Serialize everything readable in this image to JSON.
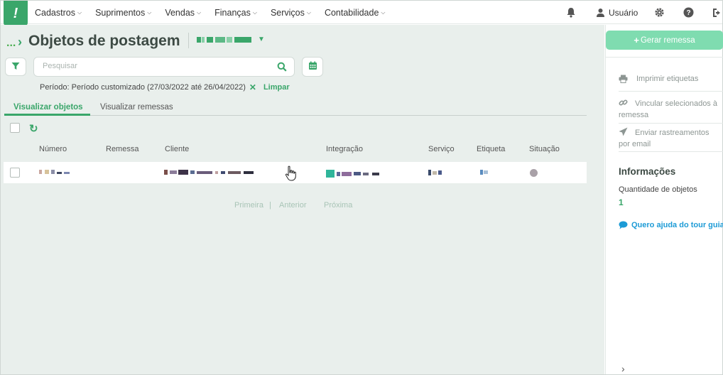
{
  "nav": {
    "logo": "!",
    "menu": [
      {
        "label": "Cadastros"
      },
      {
        "label": "Suprimentos"
      },
      {
        "label": "Vendas"
      },
      {
        "label": "Finanças"
      },
      {
        "label": "Serviços"
      },
      {
        "label": "Contabilidade"
      }
    ],
    "user_label": "Usuário",
    "icons": [
      "bell-icon",
      "user-icon",
      "gear-icon",
      "help-icon",
      "logout-icon"
    ]
  },
  "page": {
    "breadcrumb_dots": "...",
    "title": "Objetos de postagem"
  },
  "search": {
    "placeholder": "Pesquisar"
  },
  "filter": {
    "period_text": "Período: Período customizado (27/03/2022 até 26/04/2022)",
    "clear_label": "Limpar"
  },
  "tabs": [
    {
      "label": "Visualizar objetos",
      "active": true
    },
    {
      "label": "Visualizar remessas",
      "active": false
    }
  ],
  "table": {
    "columns": [
      "Número",
      "Remessa",
      "Cliente",
      "Integração",
      "Serviço",
      "Etiqueta",
      "Situação"
    ],
    "status_color": "#a9a1a8"
  },
  "pagination": {
    "first": "Primeira",
    "separator": "|",
    "previous": "Anterior",
    "next": "Próxima"
  },
  "sidebar": {
    "generate_button": "Gerar remessa",
    "actions": [
      {
        "label": "Imprimir etiquetas",
        "icon": "printer-icon"
      },
      {
        "label": "Vincular selecionados à remessa",
        "icon": "link-icon"
      },
      {
        "label": "Enviar rastreamentos por email",
        "icon": "send-icon"
      }
    ],
    "info_title": "Informações",
    "qty_label": "Quantidade de objetos",
    "qty_value": "1",
    "tour_link": "Quero ajuda do tour guia"
  },
  "colors": {
    "accent": "#3aa66a",
    "background": "#e9efec",
    "link": "#1d9bd6",
    "button_disabled": "#7fdcb0"
  }
}
